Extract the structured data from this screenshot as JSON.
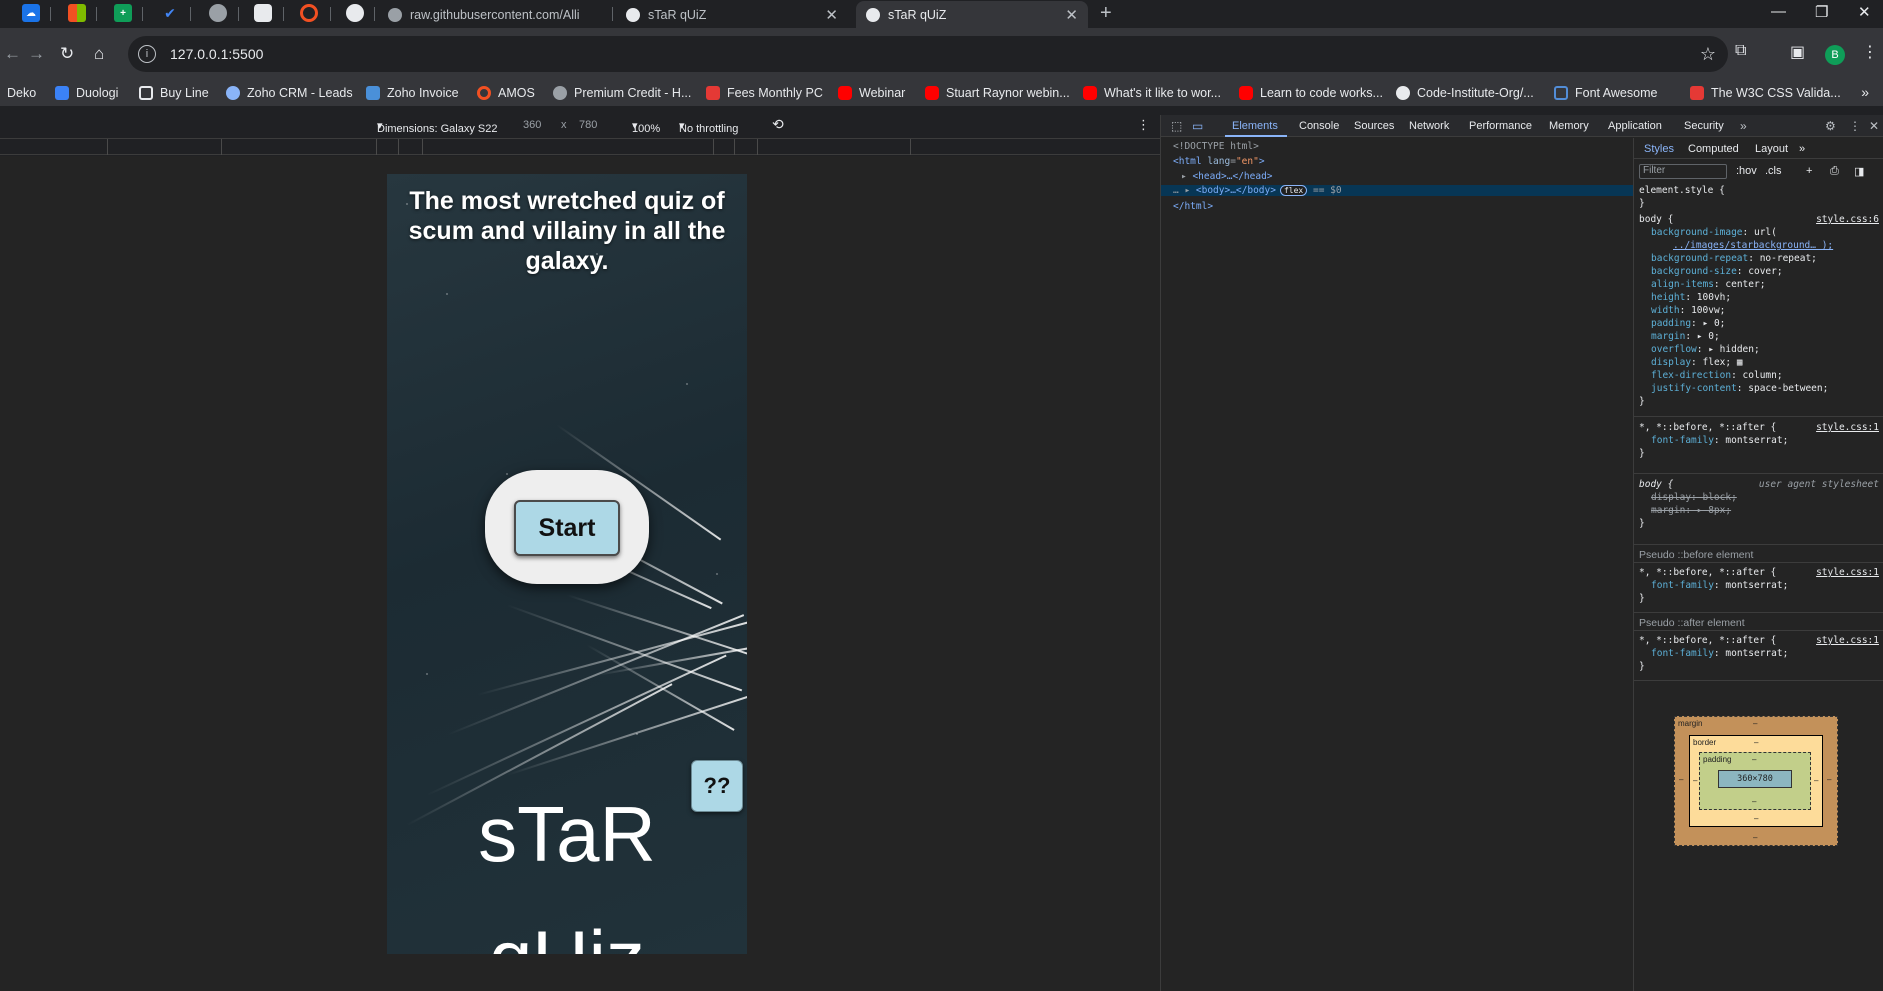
{
  "tabs": [
    {
      "title": "raw.githubusercontent.com/Alli",
      "active": false
    },
    {
      "title": "sTaR qUiZ",
      "active": false
    },
    {
      "title": "sTaR qUiZ",
      "active": true
    }
  ],
  "address": {
    "url": "127.0.0.1:5500"
  },
  "bookmarks": [
    "Deko",
    "Duologi",
    "Buy Line",
    "Zoho CRM - Leads",
    "Zoho Invoice",
    "AMOS",
    "Premium Credit - H...",
    "Fees Monthly PC",
    "Webinar",
    "Stuart Raynor webin...",
    "What's it like to wor...",
    "Learn to code works...",
    "Code-Institute-Org/...",
    "Font Awesome",
    "The W3C CSS Valida..."
  ],
  "profile_initial": "B",
  "device_toolbar": {
    "dimensions": "Dimensions: Galaxy S22",
    "width": "360",
    "x": "x",
    "height": "780",
    "zoom": "100%",
    "throttling": "No throttling"
  },
  "page": {
    "title": "The most wretched quiz of scum and villainy in all the galaxy.",
    "start_label": "Start",
    "help_label": "??",
    "logo_line1": "sTaR",
    "logo_line2": "qUiz"
  },
  "devtools": {
    "tabs": [
      "Elements",
      "Console",
      "Sources",
      "Network",
      "Performance",
      "Memory",
      "Application",
      "Security"
    ],
    "dom": {
      "doctype": "<!DOCTYPE html>",
      "html_open": "<html ",
      "lang_attr": "lang",
      "lang_val": "\"en\"",
      "head": "<head>…</head>",
      "body": "<body>…</body>",
      "flex_badge": "flex",
      "dollar": "== $0",
      "html_close": "</html>"
    },
    "styles_tabs": [
      "Styles",
      "Computed",
      "Layout"
    ],
    "filter_placeholder": "Filter",
    "hov": ":hov",
    "cls": ".cls",
    "element_style": "element.style {",
    "body_rule": {
      "selector": "body {",
      "source": "style.css:6",
      "declarations": [
        {
          "prop": "background-image",
          "value": "url("
        },
        {
          "prop": "",
          "value": "../images/starbackground… );"
        },
        {
          "prop": "background-repeat",
          "value": "no-repeat;"
        },
        {
          "prop": "background-size",
          "value": "cover;"
        },
        {
          "prop": "align-items",
          "value": "center;"
        },
        {
          "prop": "height",
          "value": "100vh;"
        },
        {
          "prop": "width",
          "value": "100vw;"
        },
        {
          "prop": "padding",
          "value": "▸ 0;"
        },
        {
          "prop": "margin",
          "value": "▸ 0;"
        },
        {
          "prop": "overflow",
          "value": "▸ hidden;"
        },
        {
          "prop": "display",
          "value": "flex;"
        },
        {
          "prop": "flex-direction",
          "value": "column;"
        },
        {
          "prop": "justify-content",
          "value": "space-between;"
        }
      ]
    },
    "universal_rule": {
      "selector": "*, *::before, *::after {",
      "source": "style.css:1",
      "prop": "font-family",
      "value": "montserrat;"
    },
    "ua_rule": {
      "selector": "body {",
      "source": "user agent stylesheet",
      "d1": "display: block;",
      "d2": "margin: ▸ 8px;"
    },
    "pseudo_before": "Pseudo ::before element",
    "pseudo_after": "Pseudo ::after element",
    "box_model": {
      "margin": "margin",
      "border": "border",
      "padding": "padding",
      "content": "360×780",
      "dash": "–"
    }
  }
}
